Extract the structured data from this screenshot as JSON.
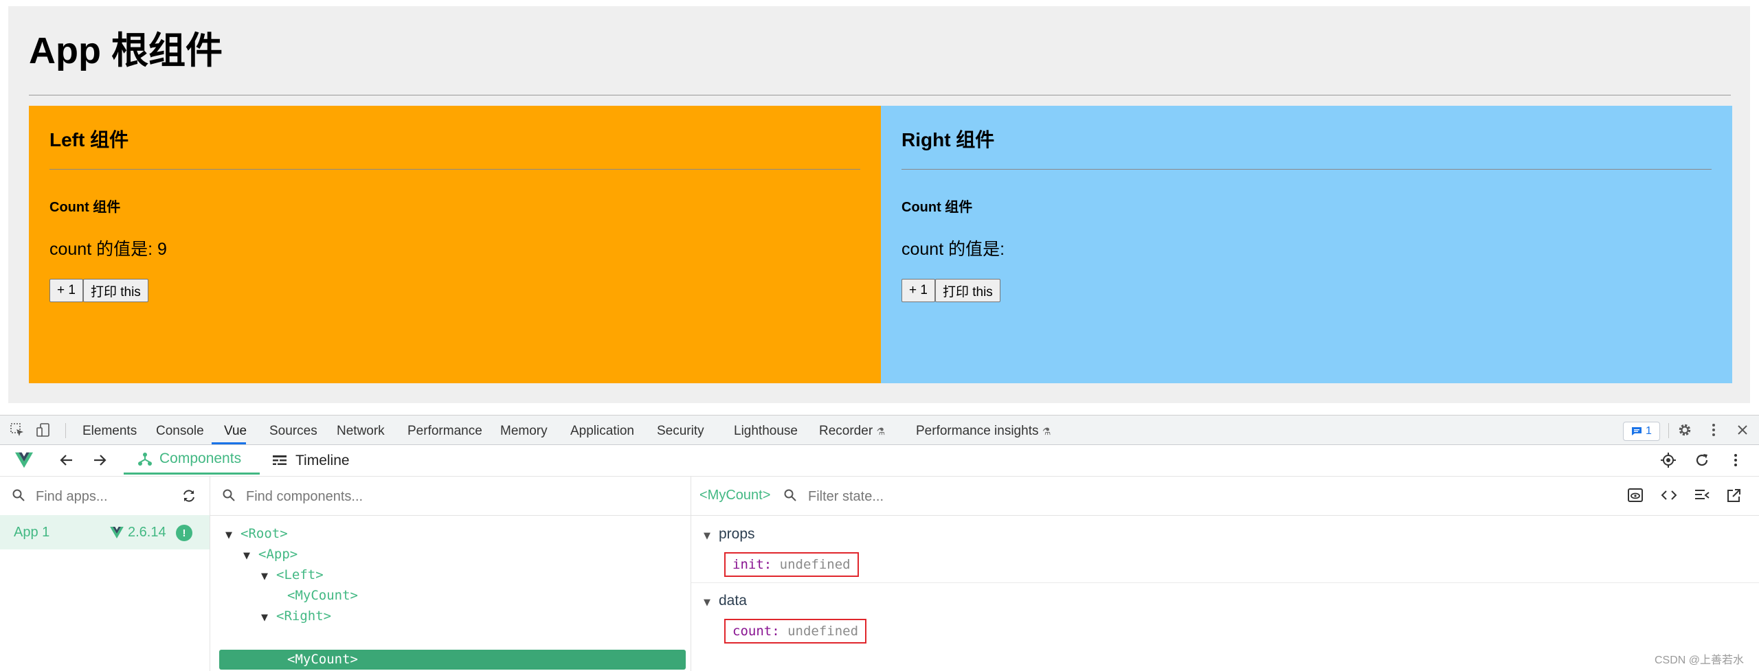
{
  "app": {
    "title": "App 根组件",
    "left": {
      "title": "Left 组件",
      "count_title": "Count 组件",
      "count_text": "count 的值是: 9",
      "btn_inc": "+ 1",
      "btn_print": "打印 this"
    },
    "right": {
      "title": "Right 组件",
      "count_title": "Count 组件",
      "count_text": "count 的值是:",
      "btn_inc": "+ 1",
      "btn_print": "打印 this"
    }
  },
  "devtools": {
    "tabs": [
      "Elements",
      "Console",
      "Vue",
      "Sources",
      "Network",
      "Performance",
      "Memory",
      "Application",
      "Security",
      "Lighthouse",
      "Recorder",
      "Performance insights"
    ],
    "active_tab": "Vue",
    "issues_count": "1",
    "vue": {
      "tab_components": "Components",
      "tab_timeline": "Timeline",
      "apps_search_placeholder": "Find apps...",
      "components_search_placeholder": "Find components...",
      "state_search_placeholder": "Filter state...",
      "selected_component": "<MyCount>",
      "app_name": "App 1",
      "vue_version": "2.6.14",
      "tree": [
        "<Root>",
        "<App>",
        "<Left>",
        "<MyCount>",
        "<Right>",
        "<MyCount>"
      ],
      "props_label": "props",
      "data_label": "data",
      "props": [
        {
          "key": "init",
          "value": "undefined"
        }
      ],
      "data": [
        {
          "key": "count",
          "value": "undefined"
        }
      ]
    }
  },
  "watermark": "CSDN @上善若水",
  "colors": {
    "left_bg": "#ffa500",
    "right_bg": "#87cefa",
    "vue_green": "#42b883",
    "selection": "#3ba776",
    "highlight_box": "#e0262c"
  }
}
